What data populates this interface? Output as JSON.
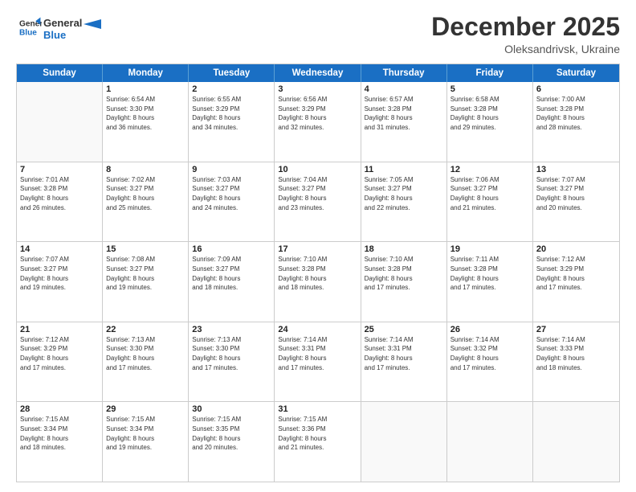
{
  "logo": {
    "general": "General",
    "blue": "Blue"
  },
  "title": "December 2025",
  "location": "Oleksandrivsk, Ukraine",
  "header_days": [
    "Sunday",
    "Monday",
    "Tuesday",
    "Wednesday",
    "Thursday",
    "Friday",
    "Saturday"
  ],
  "weeks": [
    [
      {
        "day": "",
        "info": ""
      },
      {
        "day": "1",
        "info": "Sunrise: 6:54 AM\nSunset: 3:30 PM\nDaylight: 8 hours\nand 36 minutes."
      },
      {
        "day": "2",
        "info": "Sunrise: 6:55 AM\nSunset: 3:29 PM\nDaylight: 8 hours\nand 34 minutes."
      },
      {
        "day": "3",
        "info": "Sunrise: 6:56 AM\nSunset: 3:29 PM\nDaylight: 8 hours\nand 32 minutes."
      },
      {
        "day": "4",
        "info": "Sunrise: 6:57 AM\nSunset: 3:28 PM\nDaylight: 8 hours\nand 31 minutes."
      },
      {
        "day": "5",
        "info": "Sunrise: 6:58 AM\nSunset: 3:28 PM\nDaylight: 8 hours\nand 29 minutes."
      },
      {
        "day": "6",
        "info": "Sunrise: 7:00 AM\nSunset: 3:28 PM\nDaylight: 8 hours\nand 28 minutes."
      }
    ],
    [
      {
        "day": "7",
        "info": "Sunrise: 7:01 AM\nSunset: 3:28 PM\nDaylight: 8 hours\nand 26 minutes."
      },
      {
        "day": "8",
        "info": "Sunrise: 7:02 AM\nSunset: 3:27 PM\nDaylight: 8 hours\nand 25 minutes."
      },
      {
        "day": "9",
        "info": "Sunrise: 7:03 AM\nSunset: 3:27 PM\nDaylight: 8 hours\nand 24 minutes."
      },
      {
        "day": "10",
        "info": "Sunrise: 7:04 AM\nSunset: 3:27 PM\nDaylight: 8 hours\nand 23 minutes."
      },
      {
        "day": "11",
        "info": "Sunrise: 7:05 AM\nSunset: 3:27 PM\nDaylight: 8 hours\nand 22 minutes."
      },
      {
        "day": "12",
        "info": "Sunrise: 7:06 AM\nSunset: 3:27 PM\nDaylight: 8 hours\nand 21 minutes."
      },
      {
        "day": "13",
        "info": "Sunrise: 7:07 AM\nSunset: 3:27 PM\nDaylight: 8 hours\nand 20 minutes."
      }
    ],
    [
      {
        "day": "14",
        "info": "Sunrise: 7:07 AM\nSunset: 3:27 PM\nDaylight: 8 hours\nand 19 minutes."
      },
      {
        "day": "15",
        "info": "Sunrise: 7:08 AM\nSunset: 3:27 PM\nDaylight: 8 hours\nand 19 minutes."
      },
      {
        "day": "16",
        "info": "Sunrise: 7:09 AM\nSunset: 3:27 PM\nDaylight: 8 hours\nand 18 minutes."
      },
      {
        "day": "17",
        "info": "Sunrise: 7:10 AM\nSunset: 3:28 PM\nDaylight: 8 hours\nand 18 minutes."
      },
      {
        "day": "18",
        "info": "Sunrise: 7:10 AM\nSunset: 3:28 PM\nDaylight: 8 hours\nand 17 minutes."
      },
      {
        "day": "19",
        "info": "Sunrise: 7:11 AM\nSunset: 3:28 PM\nDaylight: 8 hours\nand 17 minutes."
      },
      {
        "day": "20",
        "info": "Sunrise: 7:12 AM\nSunset: 3:29 PM\nDaylight: 8 hours\nand 17 minutes."
      }
    ],
    [
      {
        "day": "21",
        "info": "Sunrise: 7:12 AM\nSunset: 3:29 PM\nDaylight: 8 hours\nand 17 minutes."
      },
      {
        "day": "22",
        "info": "Sunrise: 7:13 AM\nSunset: 3:30 PM\nDaylight: 8 hours\nand 17 minutes."
      },
      {
        "day": "23",
        "info": "Sunrise: 7:13 AM\nSunset: 3:30 PM\nDaylight: 8 hours\nand 17 minutes."
      },
      {
        "day": "24",
        "info": "Sunrise: 7:14 AM\nSunset: 3:31 PM\nDaylight: 8 hours\nand 17 minutes."
      },
      {
        "day": "25",
        "info": "Sunrise: 7:14 AM\nSunset: 3:31 PM\nDaylight: 8 hours\nand 17 minutes."
      },
      {
        "day": "26",
        "info": "Sunrise: 7:14 AM\nSunset: 3:32 PM\nDaylight: 8 hours\nand 17 minutes."
      },
      {
        "day": "27",
        "info": "Sunrise: 7:14 AM\nSunset: 3:33 PM\nDaylight: 8 hours\nand 18 minutes."
      }
    ],
    [
      {
        "day": "28",
        "info": "Sunrise: 7:15 AM\nSunset: 3:34 PM\nDaylight: 8 hours\nand 18 minutes."
      },
      {
        "day": "29",
        "info": "Sunrise: 7:15 AM\nSunset: 3:34 PM\nDaylight: 8 hours\nand 19 minutes."
      },
      {
        "day": "30",
        "info": "Sunrise: 7:15 AM\nSunset: 3:35 PM\nDaylight: 8 hours\nand 20 minutes."
      },
      {
        "day": "31",
        "info": "Sunrise: 7:15 AM\nSunset: 3:36 PM\nDaylight: 8 hours\nand 21 minutes."
      },
      {
        "day": "",
        "info": ""
      },
      {
        "day": "",
        "info": ""
      },
      {
        "day": "",
        "info": ""
      }
    ]
  ]
}
